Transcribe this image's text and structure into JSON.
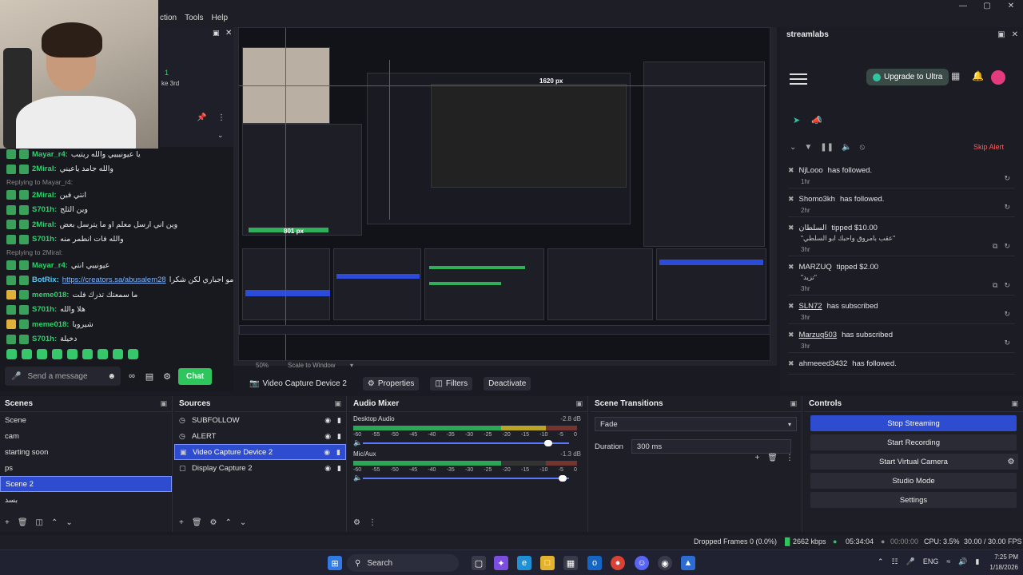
{
  "menu": {
    "items": [
      "ction",
      "Tools",
      "Help"
    ]
  },
  "chat": {
    "top_green": "1",
    "top_sub": "ke 3rd",
    "lines": [
      {
        "type": "msg",
        "badge": "g",
        "user": "Mayar_r4:",
        "msg": "يا عيونيييي والله ريتيب"
      },
      {
        "type": "msg",
        "badge": "g",
        "user": "2Miral:",
        "msg": "والله جامد ياعيني"
      },
      {
        "type": "reply",
        "text": "Replying to Mayar_r4:"
      },
      {
        "type": "msg",
        "badge": "g",
        "user": "2Miral:",
        "msg": "انتي فين"
      },
      {
        "type": "msg",
        "badge": "g",
        "user": "S701h:",
        "msg": "وين الثلج"
      },
      {
        "type": "msg",
        "badge": "g",
        "user": "2Miral:",
        "msg": "وين اني ارسل معلم او ما يترسل بعض"
      },
      {
        "type": "msg",
        "badge": "g",
        "user": "S701h:",
        "msg": "والله فات انطمر منه"
      },
      {
        "type": "reply",
        "text": "Replying to 2Miral:"
      },
      {
        "type": "msg",
        "badge": "g",
        "user": "Mayar_r4:",
        "msg": "عيونييي انتي"
      },
      {
        "type": "msg",
        "badge": "g",
        "user": "BotRix:",
        "link": "https://creators.sa/abusalem28",
        "msg": "مو اجباري لكن شكرا"
      },
      {
        "type": "msg",
        "badge": "y",
        "user": "meme018:",
        "msg": "ما سمعتك تدرك فلت"
      },
      {
        "type": "msg",
        "badge": "g",
        "user": "S701h:",
        "msg": "هلا والله"
      },
      {
        "type": "msg",
        "badge": "y",
        "user": "meme018:",
        "msg": "شيروبا"
      },
      {
        "type": "msg",
        "badge": "g",
        "user": "S701h:",
        "msg": "دخيلة"
      }
    ],
    "input_placeholder": "Send a message",
    "chat_button": "Chat"
  },
  "preview": {
    "inner_px_label": "1620 px",
    "inner_px_label2": "801 px",
    "zoom": "50%",
    "scale_mode": "Scale to Window"
  },
  "streamlabs": {
    "title": "streamlabs",
    "upgrade": "Upgrade to Ultra",
    "skip_alert": "Skip Alert",
    "feed": [
      {
        "name": "NjLooo",
        "action": "has followed.",
        "time": "1hr",
        "underline": false
      },
      {
        "name": "Shomo3kh",
        "action": "has followed.",
        "time": "2hr",
        "underline": false
      },
      {
        "name": "السلطان",
        "action": "tipped $10.00",
        "quote": "\"عقب بامروق واحبك ابو السلطي\"",
        "time": "3hr",
        "underline": false
      },
      {
        "name": "MARZUQ",
        "action": "tipped $2.00",
        "quote": "\"تزيد\"",
        "time": "3hr",
        "underline": false
      },
      {
        "name": "SLN72",
        "action": "has subscribed",
        "time": "3hr",
        "underline": true
      },
      {
        "name": "Marzuq503",
        "action": "has subscribed",
        "time": "3hr",
        "underline": true
      },
      {
        "name": "ahmeeed3432",
        "action": "has followed.",
        "time": "",
        "underline": false
      }
    ]
  },
  "source_bar": {
    "source": "Video Capture Device 2",
    "properties": "Properties",
    "filters": "Filters",
    "deactivate": "Deactivate"
  },
  "scenes": {
    "title": "Scenes",
    "items": [
      "Scene",
      "cam",
      "starting soon",
      "ps",
      "Scene 2",
      "بسد"
    ],
    "selected": 4
  },
  "sources": {
    "title": "Sources",
    "items": [
      {
        "name": "SUBFOLLOW",
        "icon": "browser-icon"
      },
      {
        "name": "ALERT",
        "icon": "browser-icon"
      },
      {
        "name": "Video Capture Device 2",
        "icon": "camera-icon"
      },
      {
        "name": "Display Capture 2",
        "icon": "monitor-icon"
      }
    ],
    "selected": 2
  },
  "mixer": {
    "title": "Audio Mixer",
    "ticks": [
      "-60",
      "-55",
      "-50",
      "-45",
      "-40",
      "-35",
      "-30",
      "-25",
      "-20",
      "-15",
      "-10",
      "-5",
      "0"
    ],
    "channels": [
      {
        "name": "Desktop Audio",
        "db": "-2.8 dB",
        "level": 0.86,
        "volume": 0.9
      },
      {
        "name": "Mic/Aux",
        "db": "-1.3 dB",
        "level": 0.66,
        "volume": 0.97
      }
    ]
  },
  "transitions": {
    "title": "Scene Transitions",
    "selected": "Fade",
    "duration_label": "Duration",
    "duration_value": "300 ms"
  },
  "controls": {
    "title": "Controls",
    "buttons": [
      "Stop Streaming",
      "Start Recording",
      "Start Virtual Camera",
      "Studio Mode",
      "Settings"
    ]
  },
  "status": {
    "dropped": "Dropped Frames 0 (0.0%)",
    "bitrate": "2662 kbps",
    "live_time": "05:34:04",
    "rec_time": "00:00:00",
    "cpu": "CPU: 3.5%",
    "fps": "30.00 / 30.00 FPS"
  },
  "taskbar": {
    "search": "Search",
    "lang": "ENG",
    "time": "7:25 PM",
    "date": "1/18/2026"
  },
  "colors": {
    "accent": "#2e4ccf",
    "chat_green": "#2fc55d",
    "alert_red": "#ff5c5c"
  }
}
